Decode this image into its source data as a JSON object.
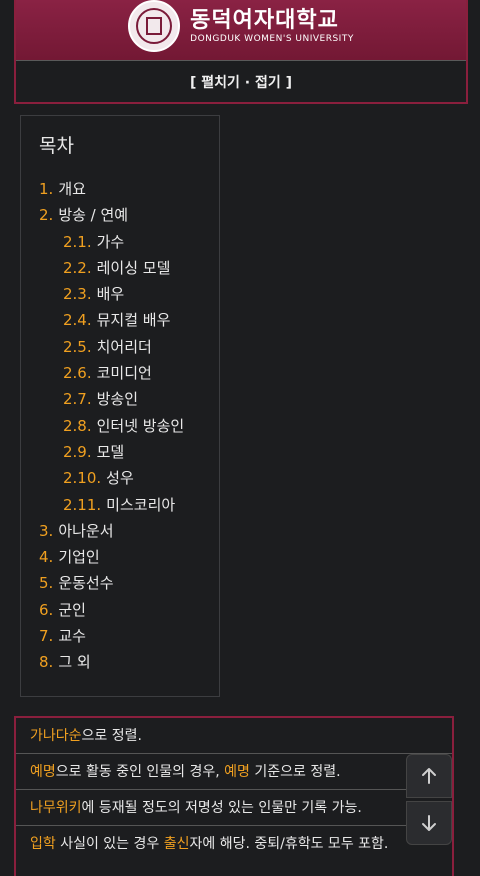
{
  "header": {
    "university_kr": "동덕여자대학교",
    "university_en": "DONGDUK WOMEN'S UNIVERSITY",
    "toggle_label": "[ 펼치기 · 접기 ]"
  },
  "toc": {
    "title": "목차",
    "items": [
      {
        "num": "1.",
        "label": "개요",
        "level": 1
      },
      {
        "num": "2.",
        "label": "방송 / 연예",
        "level": 1
      },
      {
        "num": "2.1.",
        "label": "가수",
        "level": 2
      },
      {
        "num": "2.2.",
        "label": "레이싱 모델",
        "level": 2
      },
      {
        "num": "2.3.",
        "label": "배우",
        "level": 2
      },
      {
        "num": "2.4.",
        "label": "뮤지컬 배우",
        "level": 2
      },
      {
        "num": "2.5.",
        "label": "치어리더",
        "level": 2
      },
      {
        "num": "2.6.",
        "label": "코미디언",
        "level": 2
      },
      {
        "num": "2.7.",
        "label": "방송인",
        "level": 2
      },
      {
        "num": "2.8.",
        "label": "인터넷 방송인",
        "level": 2
      },
      {
        "num": "2.9.",
        "label": "모델",
        "level": 2
      },
      {
        "num": "2.10.",
        "label": "성우",
        "level": 2
      },
      {
        "num": "2.11.",
        "label": "미스코리아",
        "level": 2
      },
      {
        "num": "3.",
        "label": "아나운서",
        "level": 1
      },
      {
        "num": "4.",
        "label": "기업인",
        "level": 1
      },
      {
        "num": "5.",
        "label": "운동선수",
        "level": 1
      },
      {
        "num": "6.",
        "label": "군인",
        "level": 1
      },
      {
        "num": "7.",
        "label": "교수",
        "level": 1
      },
      {
        "num": "8.",
        "label": "그 외",
        "level": 1
      }
    ]
  },
  "notes": {
    "row1": {
      "link": "가나다순",
      "text": "으로 정렬."
    },
    "row2": {
      "link1": "예명",
      "text1": "으로 활동 중인 인물의 경우, ",
      "link2": "예명",
      "text2": " 기준으로 정렬."
    },
    "row3": {
      "link": "나무위키",
      "text": "에 등재될 정도의 저명성 있는 인물만 기록 가능."
    },
    "row4": {
      "link1": "입학",
      "text1": " 사실이 있는 경우 ",
      "link2": "출신",
      "text2": "자에 해당. 중퇴/휴학도 모두 포함."
    }
  },
  "colors": {
    "accent": "#f0a020",
    "brand": "#7a1b39",
    "background": "#1c1d1f"
  },
  "icons": {
    "scroll_up": "arrow-up-icon",
    "scroll_down": "arrow-down-icon"
  }
}
